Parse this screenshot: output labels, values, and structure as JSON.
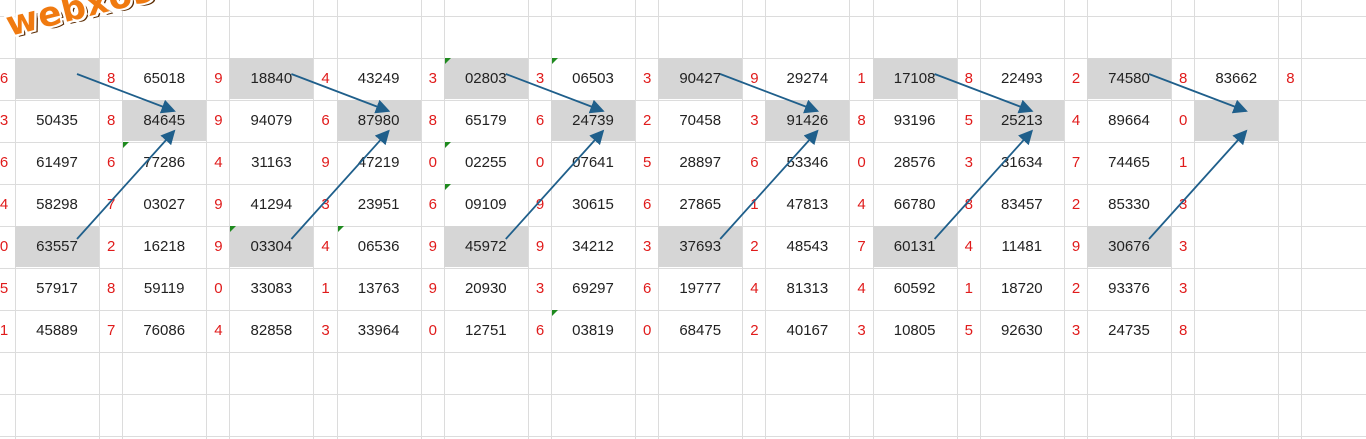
{
  "logo": "webxoso.net",
  "colors": {
    "digit": "#e01b1b",
    "highlight": "#d6d6d6",
    "arrow": "#1f5f8b",
    "grid": "#dcdcdc",
    "flag": "#1f8a1f",
    "logo": "#f07a10"
  },
  "rows": [
    [
      "6",
      "",
      "8",
      "65018",
      "9",
      "18840",
      "4",
      "43249",
      "3",
      "02803",
      "3",
      "06503",
      "3",
      "90427",
      "9",
      "29274",
      "1",
      "17108",
      "8",
      "22493",
      "2",
      "74580",
      "8",
      "83662",
      "8"
    ],
    [
      "3",
      "50435",
      "8",
      "84645",
      "9",
      "94079",
      "6",
      "87980",
      "8",
      "65179",
      "6",
      "24739",
      "2",
      "70458",
      "3",
      "91426",
      "8",
      "93196",
      "5",
      "25213",
      "4",
      "89664",
      "0",
      "",
      ""
    ],
    [
      "6",
      "61497",
      "6",
      "77286",
      "4",
      "31163",
      "9",
      "47219",
      "0",
      "02255",
      "0",
      "07641",
      "5",
      "28897",
      "6",
      "53346",
      "0",
      "28576",
      "3",
      "31634",
      "7",
      "74465",
      "1",
      "",
      ""
    ],
    [
      "4",
      "58298",
      "7",
      "03027",
      "9",
      "41294",
      "3",
      "23951",
      "6",
      "09109",
      "9",
      "30615",
      "6",
      "27865",
      "1",
      "47813",
      "4",
      "66780",
      "8",
      "83457",
      "2",
      "85330",
      "3",
      "",
      ""
    ],
    [
      "0",
      "63557",
      "2",
      "16218",
      "9",
      "03304",
      "4",
      "06536",
      "9",
      "45972",
      "9",
      "34212",
      "3",
      "37693",
      "2",
      "48543",
      "7",
      "60131",
      "4",
      "11481",
      "9",
      "30676",
      "3",
      "",
      ""
    ],
    [
      "5",
      "57917",
      "8",
      "59119",
      "0",
      "33083",
      "1",
      "13763",
      "9",
      "20930",
      "3",
      "69297",
      "6",
      "19777",
      "4",
      "81313",
      "4",
      "60592",
      "1",
      "18720",
      "2",
      "93376",
      "3",
      "",
      ""
    ],
    [
      "1",
      "45889",
      "7",
      "76086",
      "4",
      "82858",
      "3",
      "33964",
      "0",
      "12751",
      "6",
      "03819",
      "0",
      "68475",
      "2",
      "40167",
      "3",
      "10805",
      "5",
      "92630",
      "3",
      "24735",
      "8",
      "",
      ""
    ]
  ],
  "highlighted": [
    [
      0,
      1
    ],
    [
      1,
      3
    ],
    [
      4,
      1
    ],
    [
      0,
      5
    ],
    [
      1,
      7
    ],
    [
      4,
      5
    ],
    [
      0,
      9
    ],
    [
      1,
      11
    ],
    [
      4,
      9
    ],
    [
      0,
      13
    ],
    [
      1,
      15
    ],
    [
      4,
      13
    ],
    [
      0,
      17
    ],
    [
      1,
      19
    ],
    [
      4,
      17
    ],
    [
      0,
      21
    ],
    [
      1,
      23
    ],
    [
      4,
      21
    ]
  ],
  "flags": [
    [
      0,
      9
    ],
    [
      0,
      11
    ],
    [
      2,
      3
    ],
    [
      4,
      5
    ],
    [
      4,
      7
    ],
    [
      2,
      9
    ],
    [
      3,
      9
    ],
    [
      6,
      11
    ]
  ],
  "arrows": [
    [
      0,
      1,
      1,
      3
    ],
    [
      4,
      1,
      1,
      3
    ],
    [
      0,
      5,
      1,
      7
    ],
    [
      4,
      5,
      1,
      7
    ],
    [
      0,
      9,
      1,
      11
    ],
    [
      4,
      9,
      1,
      11
    ],
    [
      0,
      13,
      1,
      15
    ],
    [
      4,
      13,
      1,
      15
    ],
    [
      0,
      17,
      1,
      19
    ],
    [
      4,
      17,
      1,
      19
    ],
    [
      0,
      21,
      1,
      23
    ],
    [
      4,
      21,
      1,
      23
    ]
  ]
}
